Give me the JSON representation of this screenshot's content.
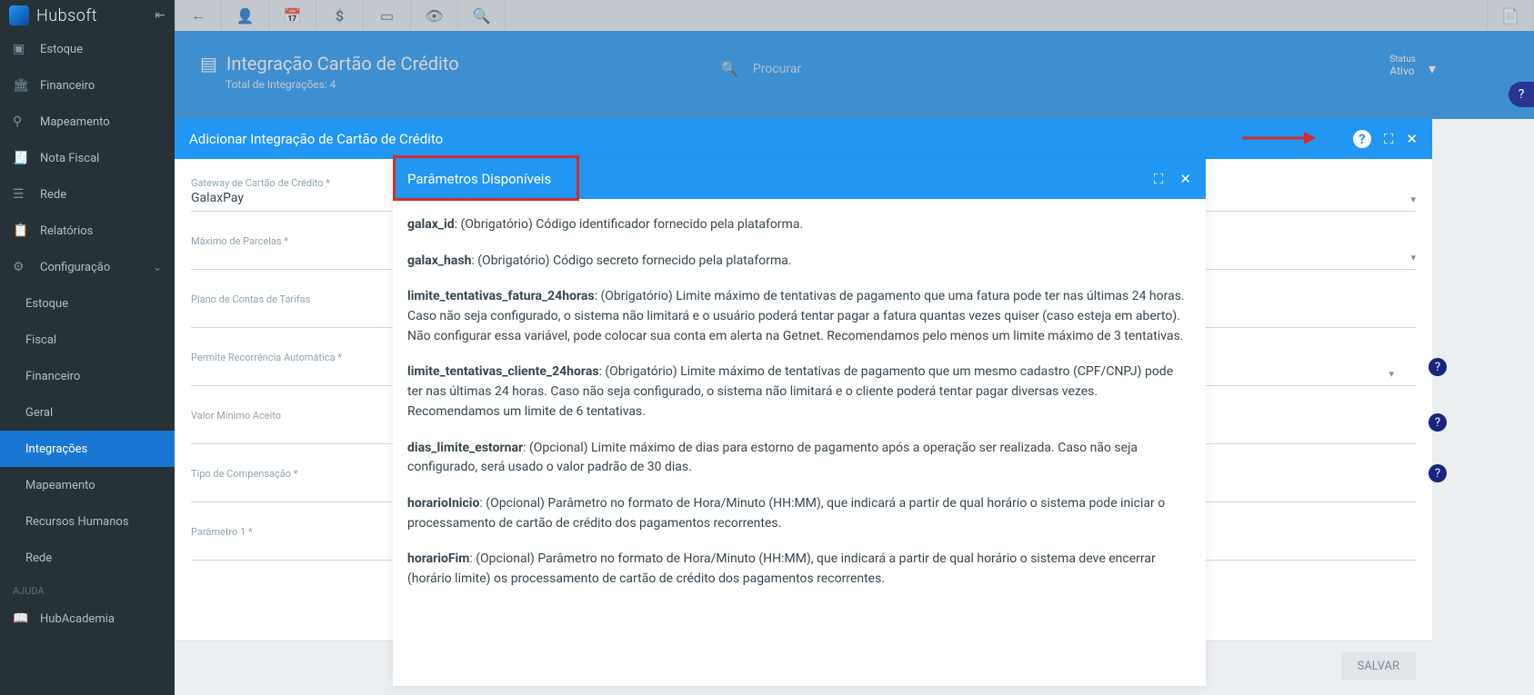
{
  "brand": "Hubsoft",
  "sidebar": {
    "items": [
      {
        "label": "Estoque",
        "icon": "cube"
      },
      {
        "label": "Financeiro",
        "icon": "bank"
      },
      {
        "label": "Mapeamento",
        "icon": "map"
      },
      {
        "label": "Nota Fiscal",
        "icon": "receipt"
      },
      {
        "label": "Rede",
        "icon": "network"
      },
      {
        "label": "Relatórios",
        "icon": "report"
      },
      {
        "label": "Configuração",
        "icon": "gear",
        "expanded": true
      }
    ],
    "subitems": [
      {
        "label": "Estoque"
      },
      {
        "label": "Fiscal"
      },
      {
        "label": "Financeiro"
      },
      {
        "label": "Geral"
      },
      {
        "label": "Integrações",
        "active": true
      },
      {
        "label": "Mapeamento"
      },
      {
        "label": "Recursos Humanos"
      },
      {
        "label": "Rede"
      }
    ],
    "help_header": "AJUDA",
    "help_item": "HubAcademia"
  },
  "page": {
    "title": "Integração Cartão de Crédito",
    "sub": "Total de Integrações: 4",
    "search_placeholder": "Procurar",
    "status_label": "Status",
    "status_value": "Ativo"
  },
  "modal": {
    "title": "Adicionar Integração de Cartão de Crédito",
    "save": "SALVAR",
    "fields": {
      "gateway_label": "Gateway de Cartão de Crédito *",
      "gateway_value": "GalaxPay",
      "max_parcelas": "Máximo de Parcelas *",
      "plano_contas": "Plano de Contas de Tarifas",
      "recorrencia": "Permite Recorrência Automática *",
      "valor_minimo": "Valor Mínimo Aceito",
      "tipo_comp": "Tipo de Compensação *",
      "param1": "Parâmetro 1 *"
    }
  },
  "popup": {
    "title": "Parâmetros Disponíveis",
    "params": [
      {
        "name": "galax_id",
        "desc": ": (Obrigatório) Código identificador fornecido pela plataforma."
      },
      {
        "name": "galax_hash",
        "desc": ": (Obrigatório) Código secreto fornecido pela plataforma."
      },
      {
        "name": "limite_tentativas_fatura_24horas",
        "desc": ": (Obrigatório) Limite máximo de tentativas de pagamento que uma fatura pode ter nas últimas 24 horas. Caso não seja configurado, o sistema não limitará e o usuário poderá tentar pagar a fatura quantas vezes quiser (caso esteja em aberto). Não configurar essa variável, pode colocar sua conta em alerta na Getnet. Recomendamos pelo menos um limite máximo de 3 tentativas."
      },
      {
        "name": "limite_tentativas_cliente_24horas",
        "desc": ": (Obrigatório) Limite máximo de tentativas de pagamento que um mesmo cadastro (CPF/CNPJ) pode ter nas últimas 24 horas. Caso não seja configurado, o sistema não limitará e o cliente poderá tentar pagar diversas vezes. Recomendamos um limite de 6 tentativas."
      },
      {
        "name": "dias_limite_estornar",
        "desc": ": (Opcional) Limite máximo de dias para estorno de pagamento após a operação ser realizada. Caso não seja configurado, será usado o valor padrão de 30 dias."
      },
      {
        "name": "horarioInicio",
        "desc": ": (Opcional) Parâmetro no formato de Hora/Minuto (HH:MM), que indicará a partir de qual horário o sistema pode iniciar o processamento de cartão de crédito dos pagamentos recorrentes."
      },
      {
        "name": "horarioFim",
        "desc": ": (Opcional) Parâmetro no formato de Hora/Minuto (HH:MM), que indicará a partir de qual horário o sistema deve encerrar (horário limite) os processamento de cartão de crédito dos pagamentos recorrentes."
      }
    ]
  }
}
